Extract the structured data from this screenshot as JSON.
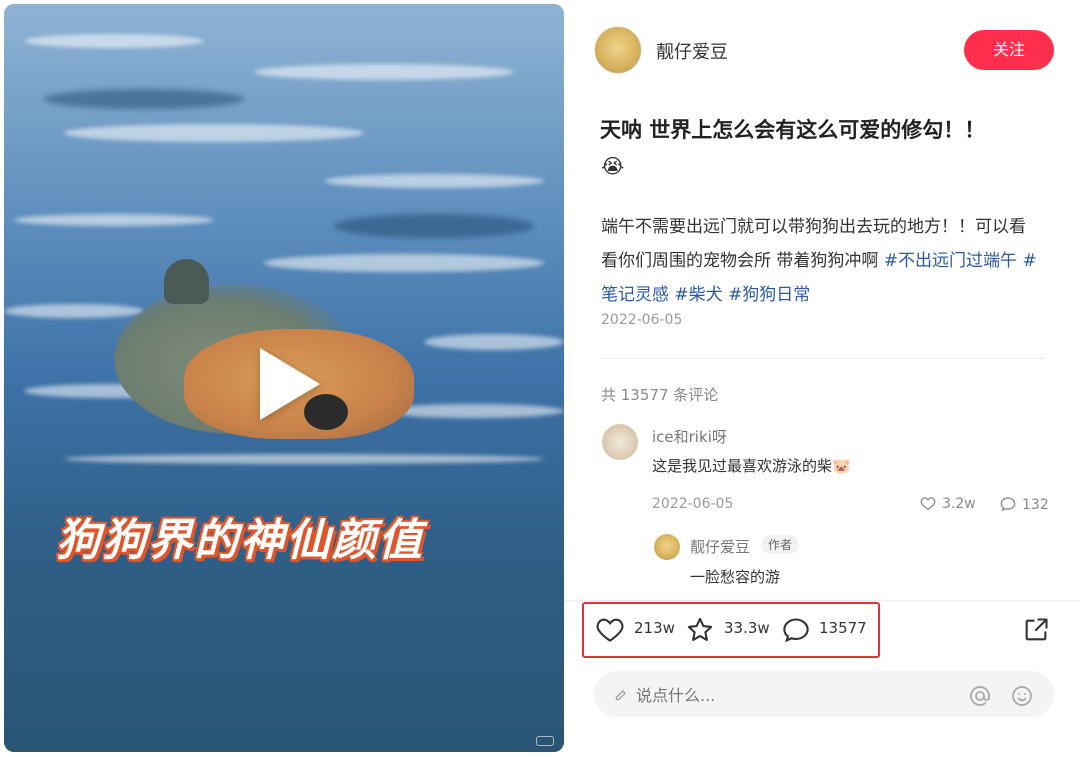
{
  "video": {
    "caption": "狗狗界的神仙颜值"
  },
  "author": {
    "name": "靓仔爱豆",
    "follow_label": "关注"
  },
  "post": {
    "title": "天呐 世界上怎么会有这么可爱的修勾！！",
    "emoji": "😭",
    "body_text": "端午不需要出远门就可以带狗狗出去玩的地方！！可以看看你们周围的宠物会所 带着狗狗冲啊 ",
    "tags": [
      "#不出远门过端午",
      "#笔记灵感",
      "#柴犬",
      "#狗狗日常"
    ],
    "date": "2022-06-05"
  },
  "comments": {
    "count_label": "共 13577 条评论",
    "items": [
      {
        "user": "ice和riki呀",
        "text": "这是我见过最喜欢游泳的柴🐷",
        "date": "2022-06-05",
        "likes": "3.2w",
        "replies": "132",
        "reply": {
          "user": "靓仔爱豆",
          "badge": "作者",
          "text": "一脸愁容的游"
        }
      }
    ]
  },
  "stats": {
    "likes": "213w",
    "collects": "33.3w",
    "comments": "13577"
  },
  "input": {
    "placeholder": "说点什么..."
  },
  "colors": {
    "accent": "#ff2e4d",
    "tag": "#2b5aa3",
    "highlight": "#e0333a"
  }
}
